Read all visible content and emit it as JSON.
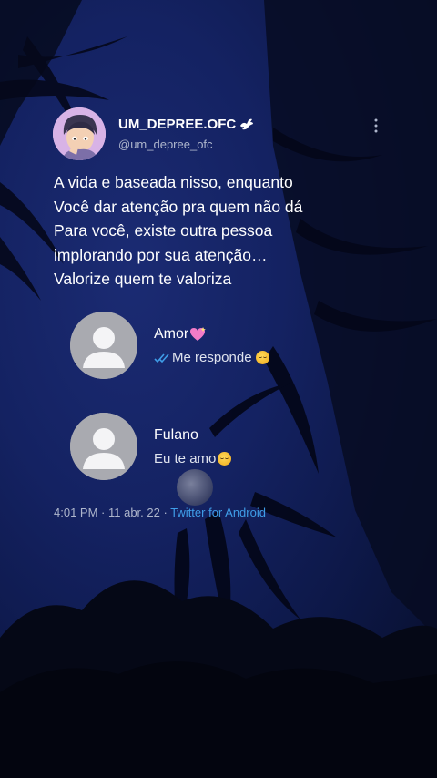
{
  "tweet": {
    "display_name": "UM_DEPREE.OFC",
    "handle": "@um_depree_ofc",
    "text_lines": [
      "A vida e baseada nisso, enquanto",
      "Você dar atenção pra quem não dá",
      "Para você, existe outra pessoa",
      "implorando por sua atenção…",
      "Valorize quem te valoriza"
    ],
    "meta": {
      "time": "4:01 PM",
      "separator1": " · ",
      "date": "11 abr. 22",
      "separator2": " · ",
      "source": "Twitter for Android"
    }
  },
  "chats": [
    {
      "name": "Amor",
      "message": "Me responde",
      "name_emoji": "sparkling-heart-icon",
      "read_receipt": "double-check-icon",
      "message_emoji": "pleading-face-icon"
    },
    {
      "name": "Fulano",
      "message": "Eu te amo",
      "message_emoji": "pleading-face-icon"
    }
  ],
  "colors": {
    "background": "#142262",
    "text": "#ffffff",
    "muted": "#aeb6cc",
    "link": "#3f9de8",
    "avatar_placeholder": "#a9aab0",
    "profile_avatar_bg": "#d8b3e6",
    "heart": "#f27cc8"
  },
  "icons": [
    "dove-icon",
    "more-vertical-icon",
    "default-user-avatar-icon",
    "moon-icon"
  ]
}
